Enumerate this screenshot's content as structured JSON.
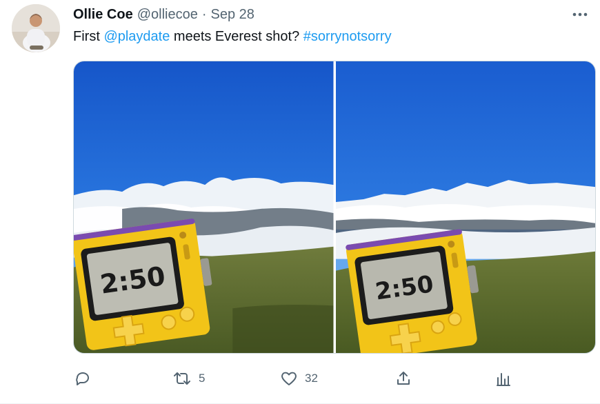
{
  "tweet": {
    "author_name": "Ollie Coe",
    "author_handle": "@olliecoe",
    "separator": "·",
    "date": "Sep 28",
    "text_prefix": "First ",
    "mention": "@playdate",
    "text_middle": " meets Everest shot? ",
    "hashtag": "#sorrynotsorry"
  },
  "media": {
    "photos": [
      {
        "screen_text": "2:50"
      },
      {
        "screen_text": "2:50"
      }
    ]
  },
  "actions": {
    "reply": {
      "icon": "reply-icon",
      "count": ""
    },
    "retweet": {
      "icon": "retweet-icon",
      "count": "5"
    },
    "like": {
      "icon": "heart-icon",
      "count": "32"
    },
    "share": {
      "icon": "share-icon"
    },
    "analytics": {
      "icon": "analytics-icon"
    }
  },
  "colors": {
    "link": "#1d9bf0",
    "secondary_text": "#536471",
    "primary_text": "#0f1419"
  }
}
